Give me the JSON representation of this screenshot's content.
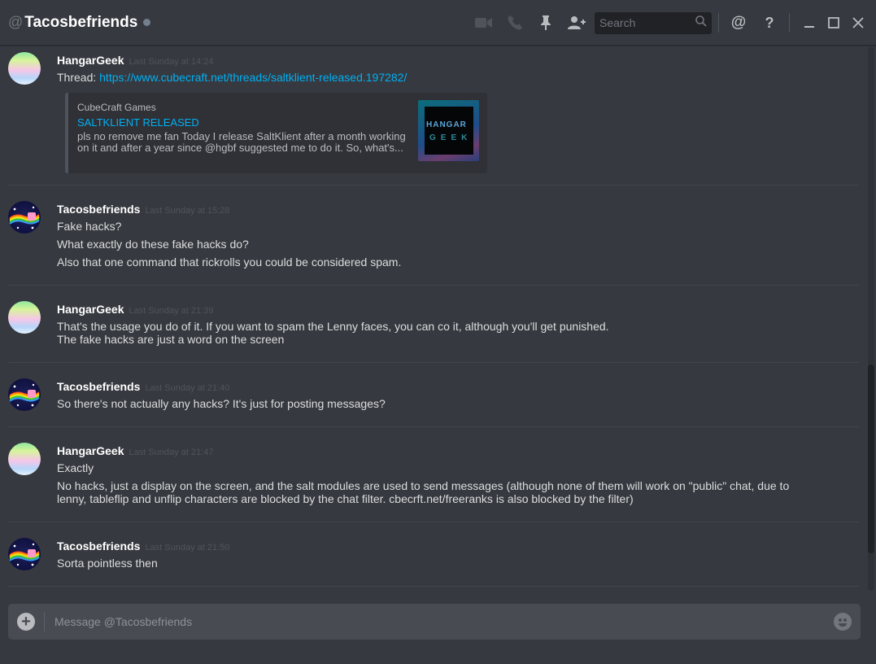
{
  "header": {
    "at_symbol": "@",
    "channel_title": "Tacosbefriends",
    "status": "offline",
    "search_placeholder": "Search",
    "icons": [
      "video-call-icon",
      "voice-call-icon",
      "pin-icon",
      "add-friend-icon",
      "search-icon",
      "mention-icon",
      "help-icon",
      "minimize-icon",
      "maximize-icon",
      "close-icon"
    ],
    "help_glyph": "?",
    "mention_glyph": "@"
  },
  "messages": [
    {
      "author": "HangarGeek",
      "timestamp": "Last Sunday at 14:24",
      "lines": [],
      "thread_prefix": "Thread: ",
      "thread_link": "https://www.cubecraft.net/threads/saltklient-released.197282/",
      "embed": {
        "provider": "CubeCraft Games",
        "title": "SALTKLIENT RELEASED",
        "description": "pls no remove me fan Today I release SaltKlient after a month working on it and after a year since @hgbf suggested me to do it. So, what's...",
        "thumb_text_1": "HANGAR",
        "thumb_text_2": "GEEK"
      }
    },
    {
      "author": "Tacosbefriends",
      "timestamp": "Last Sunday at 15:28",
      "lines": [
        "Fake hacks?",
        "What exactly do these fake hacks do?",
        "Also that one command that rickrolls you could be considered spam."
      ]
    },
    {
      "author": "HangarGeek",
      "timestamp": "Last Sunday at 21:39",
      "lines": [
        "That's the usage you do of it. If you want to spam the Lenny faces, you can co it, although you'll get punished.",
        "The fake hacks are just a word on the screen"
      ]
    },
    {
      "author": "Tacosbefriends",
      "timestamp": "Last Sunday at 21:40",
      "lines": [
        "So there's not actually any hacks? It's just for posting messages?"
      ]
    },
    {
      "author": "HangarGeek",
      "timestamp": "Last Sunday at 21:47",
      "lines": [
        "Exactly",
        "No hacks, just a display on the screen, and the salt modules are used to send messages (although none of them will work on \"public\" chat, due to",
        "lenny, tableflip and unflip characters are blocked by the chat filter. cbecrft.net/freeranks is also blocked by the filter)"
      ]
    },
    {
      "author": "Tacosbefriends",
      "timestamp": "Last Sunday at 21:50",
      "lines": [
        "Sorta pointless then"
      ]
    }
  ],
  "composer": {
    "placeholder": "Message @Tacosbefriends",
    "plus_glyph": "+"
  },
  "colors": {
    "background": "#36393f",
    "link": "#00b0f4",
    "username": "#ffffff",
    "timestamp": "#4f545c",
    "text": "#dcddde"
  }
}
